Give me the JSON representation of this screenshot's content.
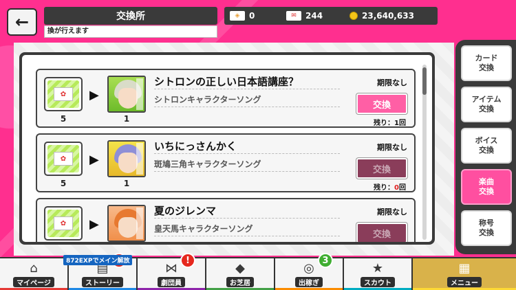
{
  "header": {
    "back_label": "←",
    "title": "交換所",
    "subtitle": "換が行えます"
  },
  "currency": [
    {
      "icon": "ticket-icon",
      "value": "0"
    },
    {
      "icon": "letter-ticket-icon",
      "value": "244"
    },
    {
      "icon": "coin-icon",
      "value": "23,640,633"
    }
  ],
  "items": [
    {
      "cost_qty": "5",
      "reward_qty": "1",
      "title": "シトロンの正しい日本語講座？",
      "subtitle": "シトロンキャラクターソング",
      "limit": "期限なし",
      "button": "交換",
      "button_state": "active",
      "remain_prefix": "残り：",
      "remain_count": "1",
      "remain_unit": "回"
    },
    {
      "cost_qty": "5",
      "reward_qty": "1",
      "title": "いちにっさんかく",
      "subtitle": "斑鳩三角キャラクターソング",
      "limit": "期限なし",
      "button": "交換",
      "button_state": "disabled",
      "remain_prefix": "残り：",
      "remain_count": "0",
      "remain_unit": "回"
    },
    {
      "cost_qty": "",
      "reward_qty": "",
      "title": "夏のジレンマ",
      "subtitle": "皇天馬キャラクターソング",
      "limit": "期限なし",
      "button": "交換",
      "button_state": "disabled",
      "remain_prefix": "",
      "remain_count": "",
      "remain_unit": ""
    }
  ],
  "side_tabs": [
    {
      "label": "カード\n交換",
      "active": false
    },
    {
      "label": "アイテム\n交換",
      "active": false
    },
    {
      "label": "ボイス\n交換",
      "active": false
    },
    {
      "label": "楽曲\n交換",
      "active": true
    },
    {
      "label": "称号\n交換",
      "active": false
    }
  ],
  "nav": [
    {
      "label": "マイページ",
      "icon": "home-icon",
      "color": "#e53935"
    },
    {
      "label": "ストーリー",
      "icon": "book-icon",
      "color": "#1e88e5",
      "badge": "!"
    },
    {
      "label": "劇団員",
      "icon": "bowtie-icon",
      "color": "#8e24aa",
      "badge": "!"
    },
    {
      "label": "お芝居",
      "icon": "mask-icon",
      "color": "#43a047"
    },
    {
      "label": "出稼ぎ",
      "icon": "coins-icon",
      "color": "#fb8c00",
      "badge": "3"
    },
    {
      "label": "スカウト",
      "icon": "star-ticket-icon",
      "color": "#00acc1"
    },
    {
      "label": "メニュー",
      "icon": "grid-icon",
      "color": "#fdd835"
    }
  ],
  "exp_banner": "872EXPでメイン解放",
  "colors": {
    "accent": "#ff4fa0",
    "dark": "#3a3a3a",
    "disabled": "#8a3d5a"
  }
}
